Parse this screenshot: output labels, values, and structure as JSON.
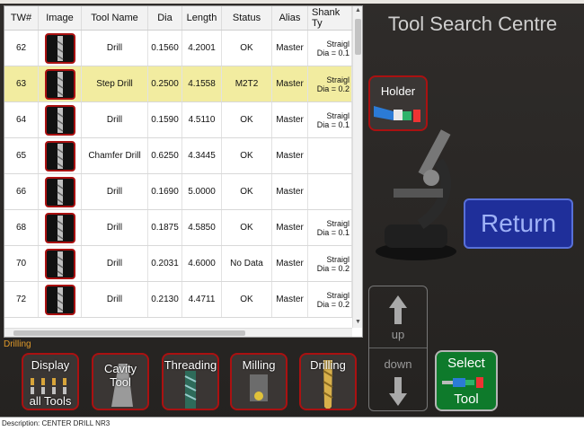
{
  "title": "Tool Search Centre",
  "table": {
    "headers": [
      "TW#",
      "Image",
      "Tool Name",
      "Dia",
      "Length",
      "Status",
      "Alias",
      "Shank Ty"
    ],
    "rows": [
      {
        "tw": "62",
        "name": "Drill",
        "dia": "0.1560",
        "length": "4.2001",
        "status": "OK",
        "alias": "Master",
        "shank1": "Straigl",
        "shank2": "Dia = 0.1",
        "selected": false
      },
      {
        "tw": "63",
        "name": "Step Drill",
        "dia": "0.2500",
        "length": "4.1558",
        "status": "M2T2",
        "alias": "Master",
        "shank1": "Straigl",
        "shank2": "Dia = 0.2",
        "selected": true
      },
      {
        "tw": "64",
        "name": "Drill",
        "dia": "0.1590",
        "length": "4.5110",
        "status": "OK",
        "alias": "Master",
        "shank1": "Straigl",
        "shank2": "Dia = 0.1",
        "selected": false
      },
      {
        "tw": "65",
        "name": "Chamfer Drill",
        "dia": "0.6250",
        "length": "4.3445",
        "status": "OK",
        "alias": "Master",
        "shank1": "",
        "shank2": "",
        "selected": false
      },
      {
        "tw": "66",
        "name": "Drill",
        "dia": "0.1690",
        "length": "5.0000",
        "status": "OK",
        "alias": "Master",
        "shank1": "",
        "shank2": "",
        "selected": false
      },
      {
        "tw": "68",
        "name": "Drill",
        "dia": "0.1875",
        "length": "4.5850",
        "status": "OK",
        "alias": "Master",
        "shank1": "Straigl",
        "shank2": "Dia = 0.1",
        "selected": false
      },
      {
        "tw": "70",
        "name": "Drill",
        "dia": "0.2031",
        "length": "4.6000",
        "status": "No Data",
        "alias": "Master",
        "shank1": "Straigl",
        "shank2": "Dia = 0.2",
        "selected": false
      },
      {
        "tw": "72",
        "name": "Drill",
        "dia": "0.2130",
        "length": "4.4711",
        "status": "OK",
        "alias": "Master",
        "shank1": "Straigl",
        "shank2": "Dia = 0.2",
        "selected": false
      }
    ]
  },
  "category_label": "Drilling",
  "buttons": {
    "display": "Display",
    "display_sub": "all Tools",
    "cavity": "Cavity Tool",
    "threading": "Threading",
    "milling": "Milling",
    "drilling": "Drilling",
    "holder": "Holder",
    "return": "Return",
    "up": "up",
    "down": "down",
    "select": "Select",
    "select_sub": "Tool"
  },
  "description": "Description: CENTER DRILL NR3",
  "icons": {
    "thumb": "drill-bit-thumbnail-icon",
    "microscope": "microscope-icon"
  },
  "colors": {
    "accent_red": "#aa1111",
    "return_blue": "#1f2f9a",
    "select_green": "#0e7a2b",
    "selected_row": "#f2eca0",
    "category_orange": "#e09a2a"
  }
}
